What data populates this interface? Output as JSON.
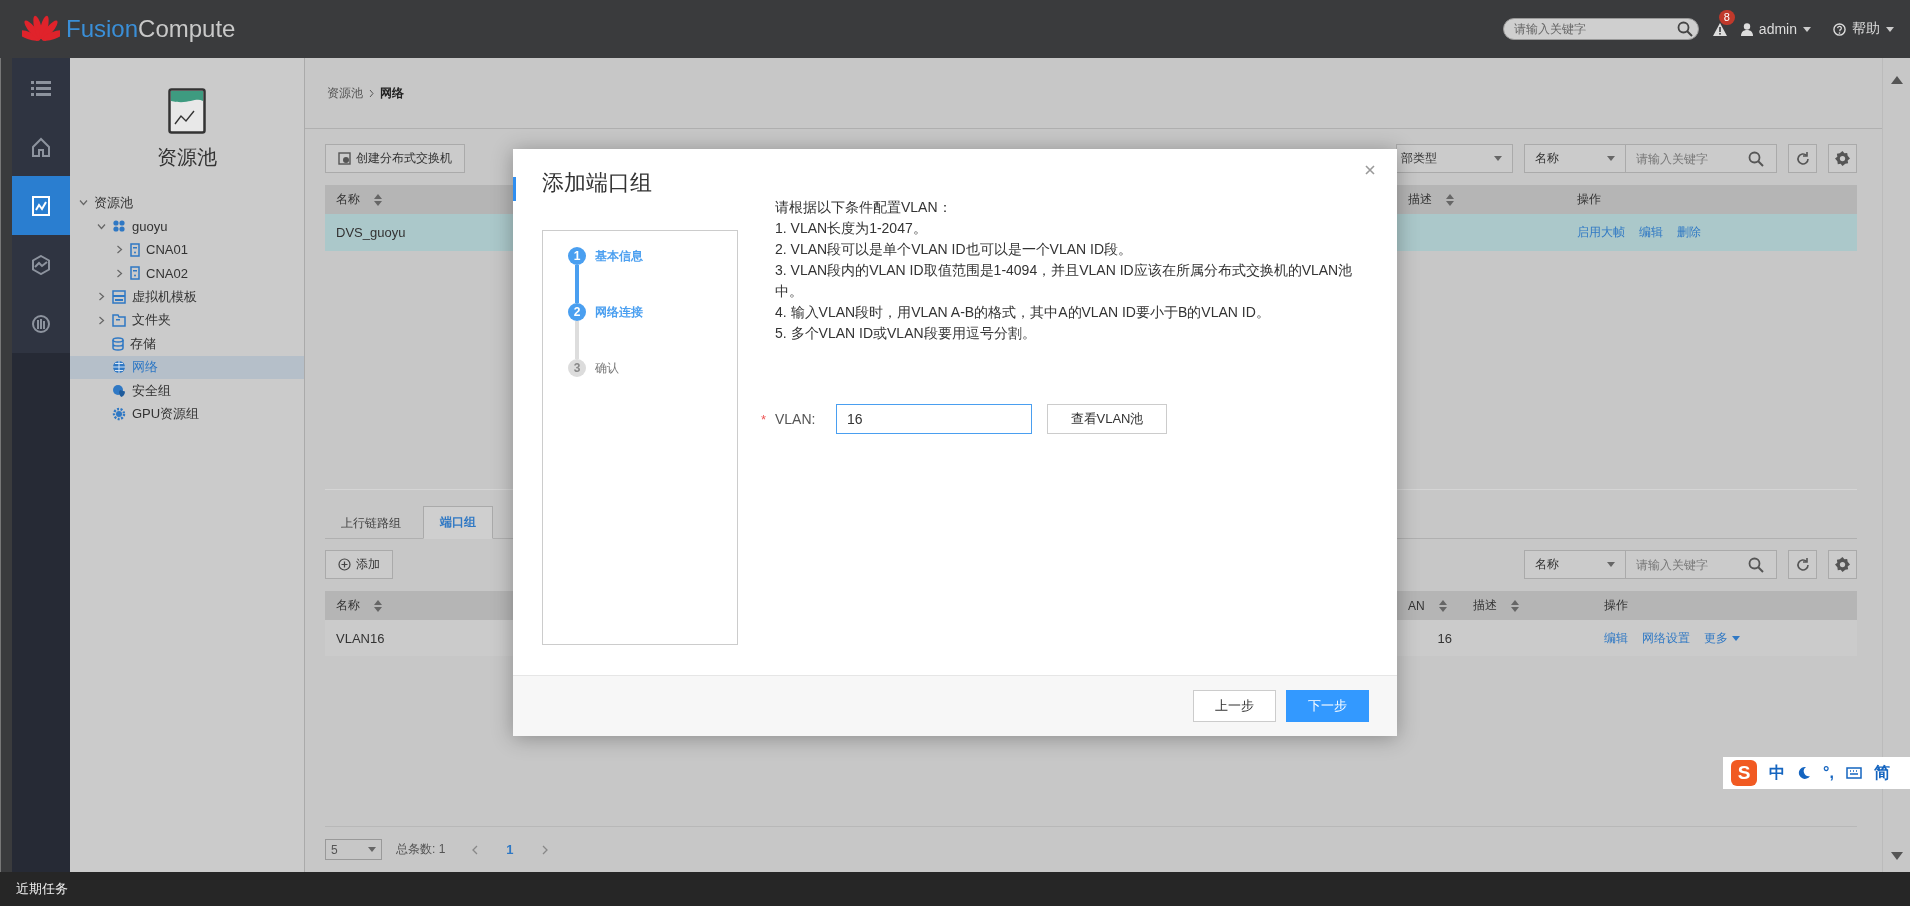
{
  "header": {
    "logo_word_1": "Fusion",
    "logo_word_2": "Compute",
    "search": {
      "placeholder": "请输入关键字"
    },
    "alerts_badge": "8",
    "user": "admin",
    "help": "帮助"
  },
  "nav_rail": [
    {
      "kind": "list",
      "selected": false
    },
    {
      "kind": "home",
      "selected": false
    },
    {
      "kind": "resources",
      "selected": true
    },
    {
      "kind": "network",
      "selected": false
    },
    {
      "kind": "monitor",
      "selected": false
    }
  ],
  "sidebar": {
    "title": "资源池",
    "tree": [
      {
        "label": "资源池",
        "expanded": true,
        "selected": false,
        "children": [
          {
            "label": "guoyu",
            "kind": "cluster",
            "expanded": true,
            "selected": false,
            "children": [
              {
                "label": "CNA01",
                "kind": "host",
                "expanded": false,
                "selected": false
              },
              {
                "label": "CNA02",
                "kind": "host",
                "expanded": false,
                "selected": false
              }
            ]
          },
          {
            "label": "虚拟机模板",
            "kind": "template",
            "expanded": false,
            "selected": false
          },
          {
            "label": "文件夹",
            "kind": "folder",
            "expanded": false,
            "selected": false
          },
          {
            "label": "存储",
            "kind": "storage",
            "selected": false
          },
          {
            "label": "网络",
            "kind": "network",
            "selected": true
          },
          {
            "label": "安全组",
            "kind": "security",
            "selected": false
          },
          {
            "label": "GPU资源组",
            "kind": "gpu",
            "selected": false
          }
        ]
      }
    ]
  },
  "breadcrumb": [
    {
      "label": "资源池",
      "current": false
    },
    {
      "label": "网络",
      "current": true
    }
  ],
  "switch_panel": {
    "create_button": "创建分布式交换机",
    "type_filter": "部类型",
    "search": {
      "field": "名称",
      "placeholder": "请输入关键字"
    },
    "columns": [
      {
        "label": "名称",
        "sortable": true
      },
      {
        "label": "描述",
        "sortable": true
      },
      {
        "label": "操作",
        "sortable": false
      }
    ],
    "rows": [
      {
        "name": "DVS_guoyu",
        "selected": true,
        "actions": [
          {
            "label": "启用大帧",
            "kind": "link"
          },
          {
            "label": "编辑",
            "kind": "link"
          },
          {
            "label": "删除",
            "kind": "link"
          }
        ]
      }
    ]
  },
  "port_panel": {
    "tabs": [
      {
        "label": "上行链路组",
        "selected": false
      },
      {
        "label": "端口组",
        "selected": true
      }
    ],
    "add_button": "添加",
    "search": {
      "field": "名称",
      "placeholder": "请输入关键字"
    },
    "columns": [
      {
        "label": "名称",
        "sortable": true
      },
      {
        "label": "AN",
        "sortable": true
      },
      {
        "label": "描述",
        "sortable": true
      },
      {
        "label": "操作",
        "sortable": false
      }
    ],
    "rows": [
      {
        "name": "VLAN16",
        "vlan": "16",
        "selected": false,
        "actions": [
          {
            "label": "编辑",
            "kind": "link"
          },
          {
            "label": "网络设置",
            "kind": "link"
          },
          {
            "label": "更多",
            "kind": "menu"
          }
        ]
      }
    ],
    "pagination": {
      "page_size": "5",
      "total": "总条数: 1",
      "page": "1"
    }
  },
  "dialog": {
    "title": "添加端口组",
    "steps": [
      {
        "number": "1",
        "label": "基本信息",
        "active": true
      },
      {
        "number": "2",
        "label": "网络连接",
        "active": true
      },
      {
        "number": "3",
        "label": "确认",
        "active": false
      }
    ],
    "instructions": [
      "请根据以下条件配置VLAN：",
      "1. VLAN长度为1-2047。",
      "2. VLAN段可以是单个VLAN ID也可以是一个VLAN ID段。",
      "3. VLAN段内的VLAN ID取值范围是1-4094，并且VLAN ID应该在所属分布式交换机的VLAN池中。",
      "4. 输入VLAN段时，用VLAN A-B的格式，其中A的VLAN ID要小于B的VLAN ID。",
      "5. 多个VLAN ID或VLAN段要用逗号分割。"
    ],
    "field": {
      "required_mark": "*",
      "label": "VLAN:",
      "value": "16"
    },
    "pool_button": "查看VLAN池",
    "buttons": [
      {
        "label": "上一步",
        "kind": "secondary"
      },
      {
        "label": "下一步",
        "kind": "primary"
      }
    ]
  },
  "status_bar": {
    "label": "近期任务"
  },
  "ime_toolbar": {
    "logo": "S",
    "mode": "中",
    "punctuation": "°,",
    "script": "简"
  }
}
